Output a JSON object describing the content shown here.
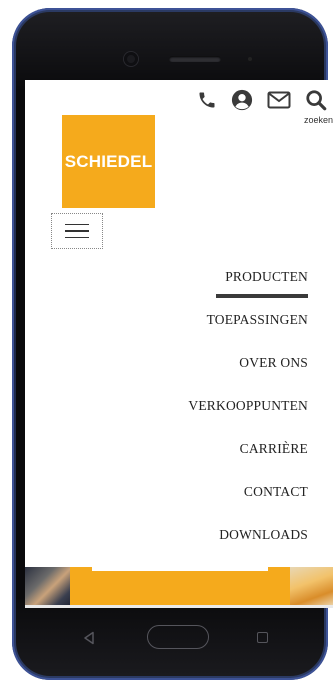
{
  "header": {
    "search_label": "zoeken"
  },
  "logo": {
    "text": "SCHIEDEL"
  },
  "nav": {
    "items": [
      {
        "label": "PRODUCTEN"
      },
      {
        "label": "TOEPASSINGEN"
      },
      {
        "label": "OVER ONS"
      },
      {
        "label": "VERKOOPPUNTEN"
      },
      {
        "label": "CARRIÈRE"
      },
      {
        "label": "CONTACT"
      },
      {
        "label": "DOWNLOADS"
      }
    ],
    "active_index": 0
  },
  "colors": {
    "brand": "#f5aa1c",
    "text": "#222222",
    "phone_frame": "#1d2747"
  },
  "icons": [
    "phone-icon",
    "user-icon",
    "mail-icon",
    "search-icon",
    "hamburger-menu-icon",
    "back-icon",
    "home-icon",
    "recent-apps-icon"
  ]
}
